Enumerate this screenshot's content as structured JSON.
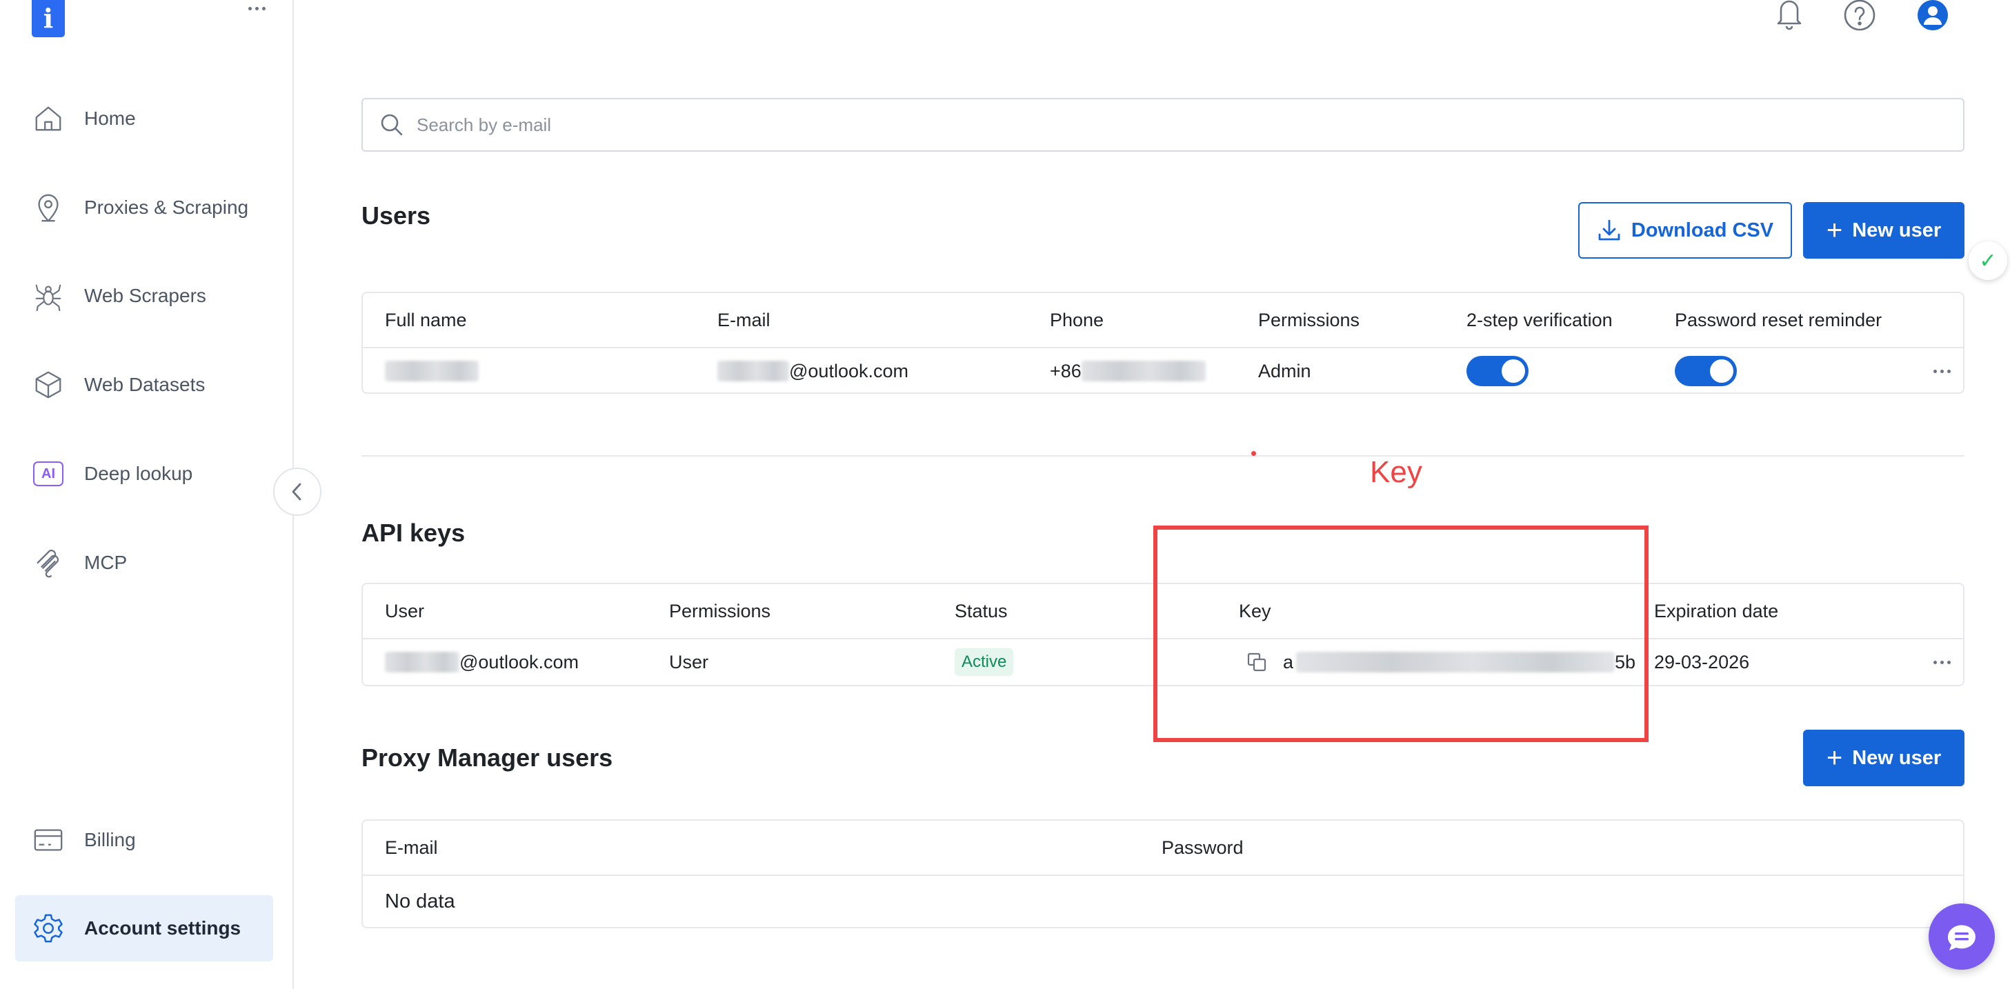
{
  "sidebar": {
    "logo": "i",
    "items": [
      {
        "label": "Home",
        "icon": "home-icon"
      },
      {
        "label": "Proxies & Scraping",
        "icon": "location-pin-icon"
      },
      {
        "label": "Web Scrapers",
        "icon": "spider-icon"
      },
      {
        "label": "Web Datasets",
        "icon": "layers-icon"
      },
      {
        "label": "Deep lookup",
        "icon": "ai-badge-icon",
        "badge": "AI"
      },
      {
        "label": "MCP",
        "icon": "mcp-icon"
      },
      {
        "label": "Billing",
        "icon": "card-icon"
      },
      {
        "label": "Account settings",
        "icon": "gear-icon",
        "active": true
      }
    ]
  },
  "search": {
    "placeholder": "Search by e-mail"
  },
  "users": {
    "title": "Users",
    "download_label": "Download CSV",
    "new_user_label": "New user",
    "columns": [
      "Full name",
      "E-mail",
      "Phone",
      "Permissions",
      "2-step verification",
      "Password reset reminder"
    ],
    "rows": [
      {
        "email_suffix": "@outlook.com",
        "phone_prefix": "+86",
        "permissions": "Admin",
        "two_step": true,
        "reset_reminder": true
      }
    ]
  },
  "annotation": {
    "label": "Key",
    "color": "#ef4444"
  },
  "api_keys": {
    "title": "API keys",
    "columns": [
      "User",
      "Permissions",
      "Status",
      "Key",
      "Expiration date"
    ],
    "rows": [
      {
        "user_suffix": "@outlook.com",
        "permissions": "User",
        "status": "Active",
        "key_prefix": "a",
        "key_suffix": "5b",
        "expiration": "29-03-2026"
      }
    ]
  },
  "proxy_manager": {
    "title": "Proxy Manager users",
    "new_user_label": "New user",
    "columns": [
      "E-mail",
      "Password"
    ],
    "empty_text": "No data"
  },
  "colors": {
    "accent": "#1565d8",
    "active_badge": "#0e8a5b",
    "annotation": "#ef4444",
    "chat": "#7c5cf0"
  }
}
